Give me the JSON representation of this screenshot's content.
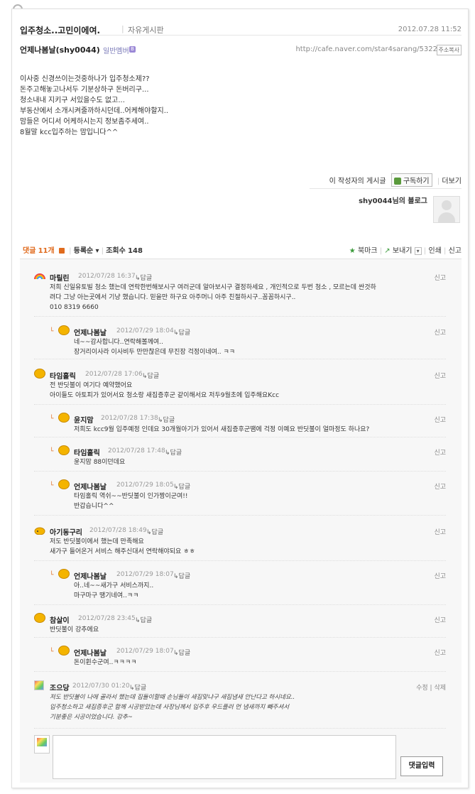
{
  "post": {
    "title": "입주청소..고민이에여.",
    "board": "자유게시판",
    "date": "2012.07.28 11:52",
    "author": "언제나봄날(shy0044)",
    "grade": "일반멤버",
    "grade_badge": "B",
    "url": "http://cafe.naver.com/star4sarang/5322",
    "copy_label": "주소복사",
    "body_lines": [
      "이사중 신경쓰이는것중하나가 입주청소제??",
      "돈주고해놓고나서두 기분상하구 돈버리구...",
      "청소내내 지키구 서있을수도 없고...",
      "부동산에서 소개시켜줄까하시던데..어케해야할지..",
      "맘들은 어디서 어케하시는지 정보좀주세여..",
      "8월말 kcc입주하는 맘입니다^^"
    ]
  },
  "author_links": {
    "posts_label": "이 작성자의 게시글",
    "subscribe_label": "구독하기",
    "more_label": "더보기",
    "blog_label": "shy0044님의 블로그"
  },
  "comment_bar": {
    "label": "댓글",
    "count": "11개",
    "sort": "등록순",
    "views_label": "조회수",
    "views": "148",
    "bookmark": "북마크",
    "send": "보내기",
    "print": "인쇄",
    "report": "신고"
  },
  "comments": [
    {
      "nick": "마릴린",
      "when": "2012/07/28 16:37",
      "reply": "답글",
      "report": "신고",
      "lines": [
        "저희 신일유토빌 청소 했는데 연락한번해보시구 여러군데 알아보시구 결정하세요 , 개인적으로 두번 청소 , 모르는데 싼것하",
        "려다 그냥 아는곳에서 기냥 했습니다. 믿을만 하구요 아주머니 아주 친절하시구..꼼꼼하시구..",
        "010 8319 6660"
      ]
    },
    {
      "nick": "언제나봄날",
      "when": "2012/07/29 18:04",
      "reply": "답글",
      "report": "신고",
      "lines": [
        "네~~감사합니다..연락해볼께여..",
        "장거리이사라 이사비두 만만찮은데 무진장 걱정이네여.. ㅋㅋ"
      ]
    },
    {
      "nick": "타임홀릭",
      "when": "2012/07/28 17:06",
      "reply": "답글",
      "report": "신고",
      "lines": [
        "전 반딧불이 여기다 예약했어요",
        "아이들도 아토피가 있어서요 청소랑 새집증후군 같이해서요 저두9월초에 입주해요Kcc"
      ]
    },
    {
      "nick": "윤지맘",
      "when": "2012/07/28 17:38",
      "reply": "답글",
      "report": "신고",
      "lines": [
        "저희도 kcc9월 입주예정 인데요 30개월아기가 있어서 새집증후군땜에 걱정 이예요 반딧불이 얼마정도 하나요?"
      ]
    },
    {
      "nick": "타임홀릭",
      "when": "2012/07/28 17:48",
      "reply": "답글",
      "report": "신고",
      "lines": [
        "윤지맘 88이던데요"
      ]
    },
    {
      "nick": "언제나봄날",
      "when": "2012/07/29 18:05",
      "reply": "답글",
      "report": "신고",
      "lines": [
        "타임홀릭 역쉬~~반딧불이 인가짱이군여!!",
        "반갑습니다^^"
      ]
    },
    {
      "nick": "아기동구리",
      "when": "2012/07/28 18:49",
      "reply": "답글",
      "report": "신고",
      "lines": [
        "저도 반딧불이에서 했는데 만족해요",
        "새가구 들어온거 서비스 해주신대서 연락해야되요 ㅎㅎ"
      ]
    },
    {
      "nick": "언제나봄날",
      "when": "2012/07/29 18:07",
      "reply": "답글",
      "report": "신고",
      "lines": [
        "아..네~~새가구 서비스까지..",
        "마구마구 땡기네여..ㅋㅋ"
      ]
    },
    {
      "nick": "참살이",
      "when": "2012/07/28 23:45",
      "reply": "답글",
      "report": "신고",
      "lines": [
        "반딧불이 강추에요"
      ]
    },
    {
      "nick": "언제나봄날",
      "when": "2012/07/29 18:07",
      "reply": "답글",
      "report": "신고",
      "lines": [
        "돈이휜수군여..ㅋㅋㅋㅋ"
      ]
    },
    {
      "nick": "조으당",
      "when": "2012/07/30 01:20",
      "reply": "답글",
      "edit": "수정",
      "delete": "삭제",
      "lines": [
        "저도 반딧불이 나에 골라서 했는데 집들이할때 손님들이 새집맞냐구 새집냄새 안난다고 하시네요..",
        "입주청소하고 새집증후군 함께 시공받았는데 사장님께서 입주후 우드플러 먼 냄새까지 빼주셔서",
        "기분좋은 시공이었습니다. 강추~"
      ]
    }
  ],
  "write": {
    "submit_label": "댓글입력"
  }
}
